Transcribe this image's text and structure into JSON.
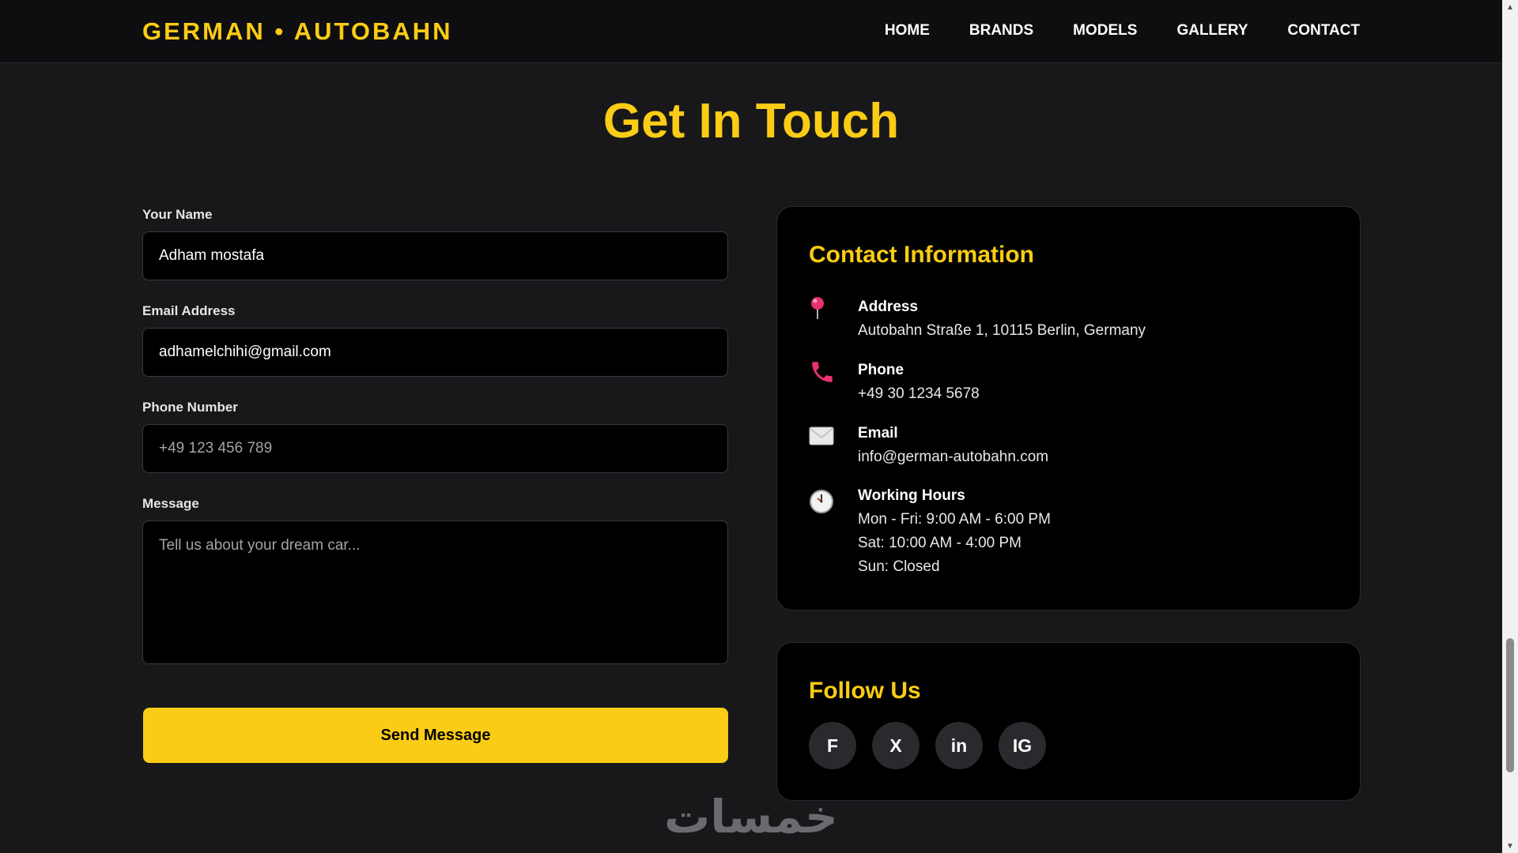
{
  "header": {
    "logo": "GERMAN • AUTOBAHN",
    "nav": [
      "HOME",
      "BRANDS",
      "MODELS",
      "GALLERY",
      "CONTACT"
    ]
  },
  "page": {
    "title": "Get In Touch"
  },
  "form": {
    "name_label": "Your Name",
    "name_value": "Adham mostafa",
    "email_label": "Email Address",
    "email_value": "adhamelchihi@gmail.com",
    "phone_label": "Phone Number",
    "phone_placeholder": "+49 123 456 789",
    "message_label": "Message",
    "message_placeholder": "Tell us about your dream car...",
    "send_label": "Send Message"
  },
  "contact_info": {
    "title": "Contact Information",
    "address_label": "Address",
    "address_value": "Autobahn Straße 1, 10115 Berlin, Germany",
    "phone_label": "Phone",
    "phone_value": "+49 30 1234 5678",
    "email_label": "Email",
    "email_value": "info@german-autobahn.com",
    "hours_label": "Working Hours",
    "hours_lines": [
      "Mon - Fri: 9:00 AM - 6:00 PM",
      "Sat: 10:00 AM - 4:00 PM",
      "Sun: Closed"
    ],
    "icons": [
      "pin-icon",
      "phone-icon",
      "envelope-icon",
      "clock-icon"
    ]
  },
  "follow": {
    "title": "Follow Us",
    "socials": [
      "F",
      "X",
      "in",
      "IG"
    ]
  },
  "watermark": "خمسات",
  "colors": {
    "accent": "#facc15",
    "background": "#18181b",
    "card": "#000000",
    "icon_pink": "#e8336d"
  }
}
